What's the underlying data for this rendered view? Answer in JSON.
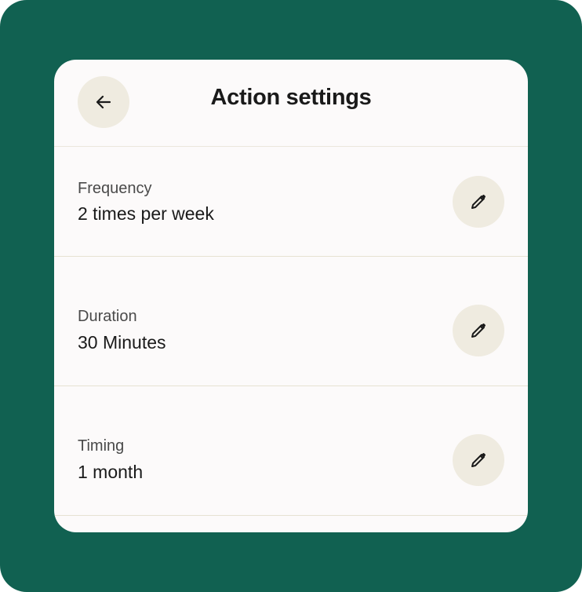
{
  "colors": {
    "frame_background": "#116151",
    "card_background": "#fcfafa",
    "button_background": "#efebe0",
    "divider": "#e6e2d2"
  },
  "header": {
    "title": "Action settings",
    "back_icon": "arrow-left-icon"
  },
  "settings": [
    {
      "label": "Frequency",
      "value": "2 times per week",
      "edit_icon": "pencil-icon"
    },
    {
      "label": "Duration",
      "value": "30 Minutes",
      "edit_icon": "pencil-icon"
    },
    {
      "label": "Timing",
      "value": "1 month",
      "edit_icon": "pencil-icon"
    }
  ]
}
